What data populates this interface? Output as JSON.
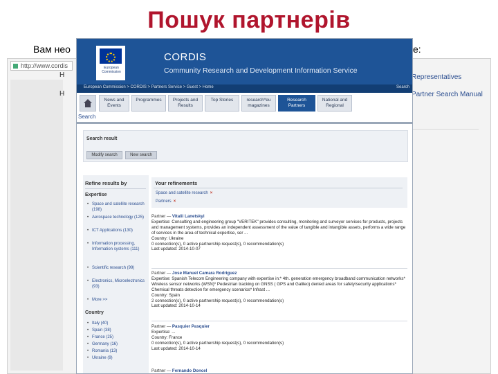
{
  "slide": {
    "title": "Пошук партнерів",
    "intro_start": "Вам нео",
    "intro_end": "е:"
  },
  "background": {
    "address_text": "http://www.cordis",
    "heading_1": "Н",
    "heading_2": "Н",
    "link_1": "Representatives",
    "link_2": "Partner Search Manual"
  },
  "cordis": {
    "eu_text": "European Commission",
    "title": "CORDIS",
    "subtitle": "Community Research and Development Information Service",
    "breadcrumb": "European Commission > CORDIS > Partners Service > Guest > Home",
    "search_link": "Search",
    "nav_tabs": [
      {
        "label": "News and Events"
      },
      {
        "label": "Programmes"
      },
      {
        "label": "Projects and Results"
      },
      {
        "label": "Top Stories"
      },
      {
        "label": "research*eu magazines"
      },
      {
        "label": "Research Partners"
      },
      {
        "label": "National and Regional"
      }
    ],
    "search_label": "Search",
    "search_result_title": "Search result",
    "modify_button": "Modify search",
    "new_search_button": "New search",
    "refine": {
      "title": "Refine results by",
      "expertise_title": "Expertise",
      "expertise": [
        "Space and satellite research (198)",
        "Aerospace technology (125)",
        "ICT Applications (130)",
        "Information processing, Information systems (111)",
        "Scientific research (99)",
        "Electronics, Microelectronics (93)",
        "More >>"
      ],
      "country_title": "Country",
      "countries": [
        "Italy (40)",
        "Spain (38)",
        "France (25)",
        "Germany (16)",
        "Romania (13)",
        "Ukraine (9)"
      ]
    },
    "refinements": {
      "title": "Your refinements",
      "items": [
        "Space and satellite research",
        "Partners"
      ],
      "remove": "×"
    },
    "results": [
      {
        "partner_prefix": "Partner — ",
        "name": "Vitalii Lanetskyi",
        "expertise": "Expertise: Consulting and engineering group \"VERITEK\" provides consulting, monitoring and surveyor services for products, projects and management systems, provides an independent assessment of the value of tangible and intangible assets, performs a wide range of services in the area of technical expertise, ser ...",
        "country": "Country: Ukraine",
        "stats": "0 connection(s), 0 active partnership request(s), 0 recommendation(s)",
        "updated": "Last updated: 2014-10-07"
      },
      {
        "partner_prefix": "Partner — ",
        "name": "Jose Manuel Camara Rodriguez",
        "expertise": "Expertise: Spanish Telecom Engineering company with expertise in:* 4th. generation emergency broadband communication networks* Wireless sensor networks (WSN)* Pedestrian tracking on GNSS ( GPS and Galileo) denied areas for safety/security applications* Chemical threats detection for emergency scenarios* Infrast ...",
        "country": "Country: Spain",
        "stats": "2 connection(s), 0 active partnership request(s), 0 recommendation(s)",
        "updated": "Last updated: 2014-10-14"
      },
      {
        "partner_prefix": "Partner — ",
        "name": "Pasquier Pasquier",
        "expertise": "Expertise: ...",
        "country": "Country: France",
        "stats": "0 connection(s), 0 active partnership request(s), 0 recommendation(s)",
        "updated": "Last updated: 2014-10-14"
      },
      {
        "partner_prefix": "Partner — ",
        "name": "Fernando Doncel",
        "expertise": "",
        "country": "",
        "stats": "",
        "updated": ""
      }
    ]
  },
  "colors": {
    "title_red": "#b0152d",
    "cordis_blue": "#1e5497",
    "link_blue": "#2a4d8f"
  }
}
